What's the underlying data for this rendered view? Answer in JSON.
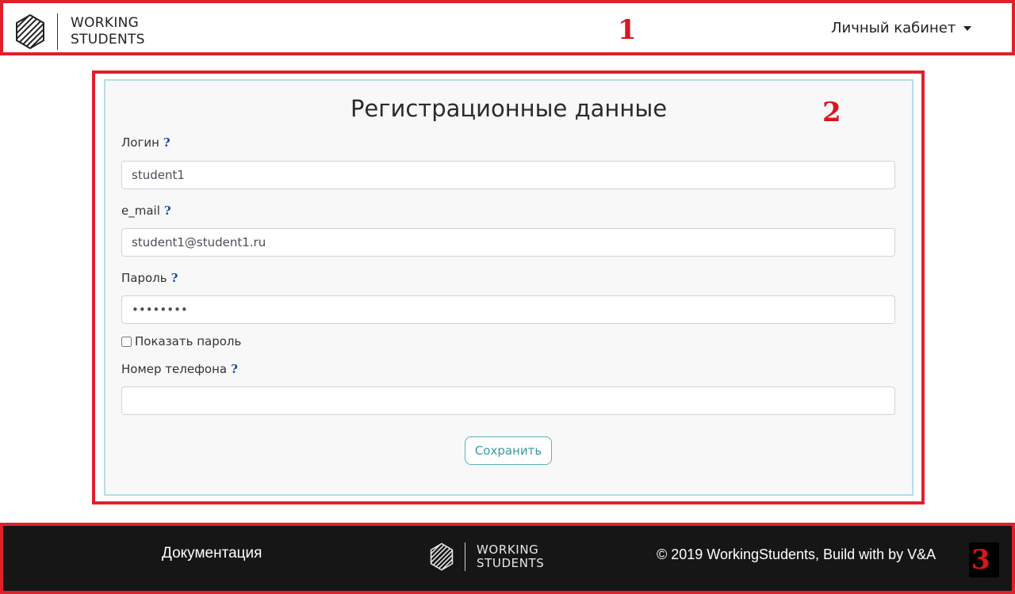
{
  "header": {
    "logo_line1": "WORKING",
    "logo_line2": "STUDENTS",
    "marker": "1",
    "cabinet_label": "Личный кабинет"
  },
  "form": {
    "title": "Регистрационные данные",
    "marker": "2",
    "help_glyph": "?",
    "login": {
      "label": "Логин",
      "value": "student1"
    },
    "email": {
      "label": "e_mail",
      "value": "student1@student1.ru"
    },
    "password": {
      "label": "Пароль",
      "value": "••••••••"
    },
    "show_password_label": "Показать пароль",
    "show_password_checked": false,
    "phone": {
      "label": "Номер телефона",
      "value": ""
    },
    "save_label": "Сохранить"
  },
  "footer": {
    "docs_label": "Документация",
    "logo_line1": "WORKING",
    "logo_line2": "STUDENTS",
    "copyright": "© 2019 WorkingStudents, Build with by V&A",
    "marker": "3"
  },
  "colors": {
    "annotation_red": "#e0202a",
    "help_blue": "#1e47a8",
    "button_teal": "#3a9aa0",
    "footer_bg": "#161616",
    "card_border": "#b8dde0"
  },
  "icons": {
    "logo": "striped-cube-logo-icon",
    "cabinet_caret": "caret-down-icon",
    "help": "question-icon"
  }
}
